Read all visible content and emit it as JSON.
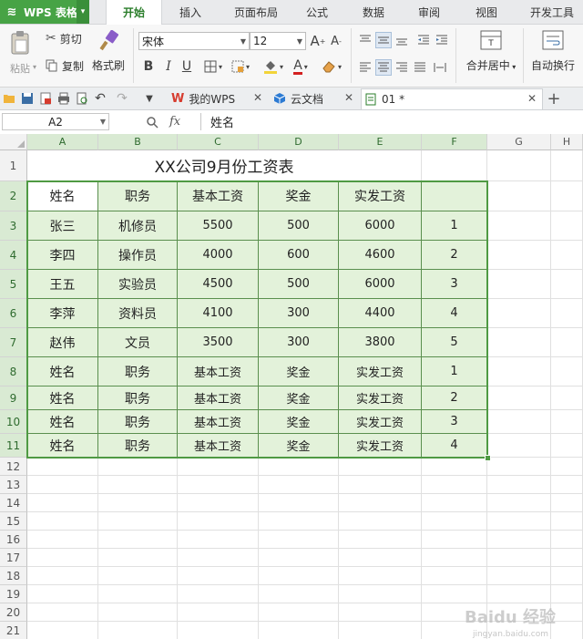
{
  "app": {
    "logo": "WPS 表格",
    "logo_icon": "wps-s-icon"
  },
  "ribbon_tabs": [
    "开始",
    "插入",
    "页面布局",
    "公式",
    "数据",
    "审阅",
    "视图",
    "开发工具"
  ],
  "active_tab": "开始",
  "toolbar": {
    "paste": "粘贴",
    "cut": "剪切",
    "copy": "复制",
    "format_painter": "格式刷",
    "font_name": "宋体",
    "font_size": "12",
    "bold": "B",
    "italic": "I",
    "underline": "U",
    "merge_center": "合并居中",
    "wrap_text": "自动换行"
  },
  "doc_tabs": [
    {
      "label": "我的WPS",
      "icon": "wps-logo-icon"
    },
    {
      "label": "云文档",
      "icon": "cloud-cube-icon"
    },
    {
      "label": "01 *",
      "icon": "sheet-file-icon"
    }
  ],
  "formula_bar": {
    "name_box": "A2",
    "fx": "fx",
    "content": "姓名"
  },
  "columns": [
    "A",
    "B",
    "C",
    "D",
    "E",
    "F",
    "G",
    "H"
  ],
  "rows": [
    "1",
    "2",
    "3",
    "4",
    "5",
    "6",
    "7",
    "8",
    "9",
    "10",
    "11",
    "12",
    "13",
    "14",
    "15",
    "16",
    "17",
    "18",
    "19",
    "20",
    "21"
  ],
  "sheet": {
    "title": "XX公司9月份工资表",
    "header": [
      "姓名",
      "职务",
      "基本工资",
      "奖金",
      "实发工资",
      ""
    ],
    "data": [
      [
        "张三",
        "机修员",
        "5500",
        "500",
        "6000",
        "1"
      ],
      [
        "李四",
        "操作员",
        "4000",
        "600",
        "4600",
        "2"
      ],
      [
        "王五",
        "实验员",
        "4500",
        "500",
        "6000",
        "3"
      ],
      [
        "李萍",
        "资料员",
        "4100",
        "300",
        "4400",
        "4"
      ],
      [
        "赵伟",
        "文员",
        "3500",
        "300",
        "3800",
        "5"
      ],
      [
        "姓名",
        "职务",
        "基本工资",
        "奖金",
        "实发工资",
        "1"
      ],
      [
        "姓名",
        "职务",
        "基本工资",
        "奖金",
        "实发工资",
        "2"
      ],
      [
        "姓名",
        "职务",
        "基本工资",
        "奖金",
        "实发工资",
        "3"
      ],
      [
        "姓名",
        "职务",
        "基本工资",
        "奖金",
        "实发工资",
        "4"
      ]
    ]
  },
  "watermark": {
    "main": "Baidu 经验",
    "sub": "jingyan.baidu.com"
  },
  "colors": {
    "accent": "#47a345",
    "selection_fill": "#e3f2da",
    "selection_border": "#4f9a43"
  }
}
